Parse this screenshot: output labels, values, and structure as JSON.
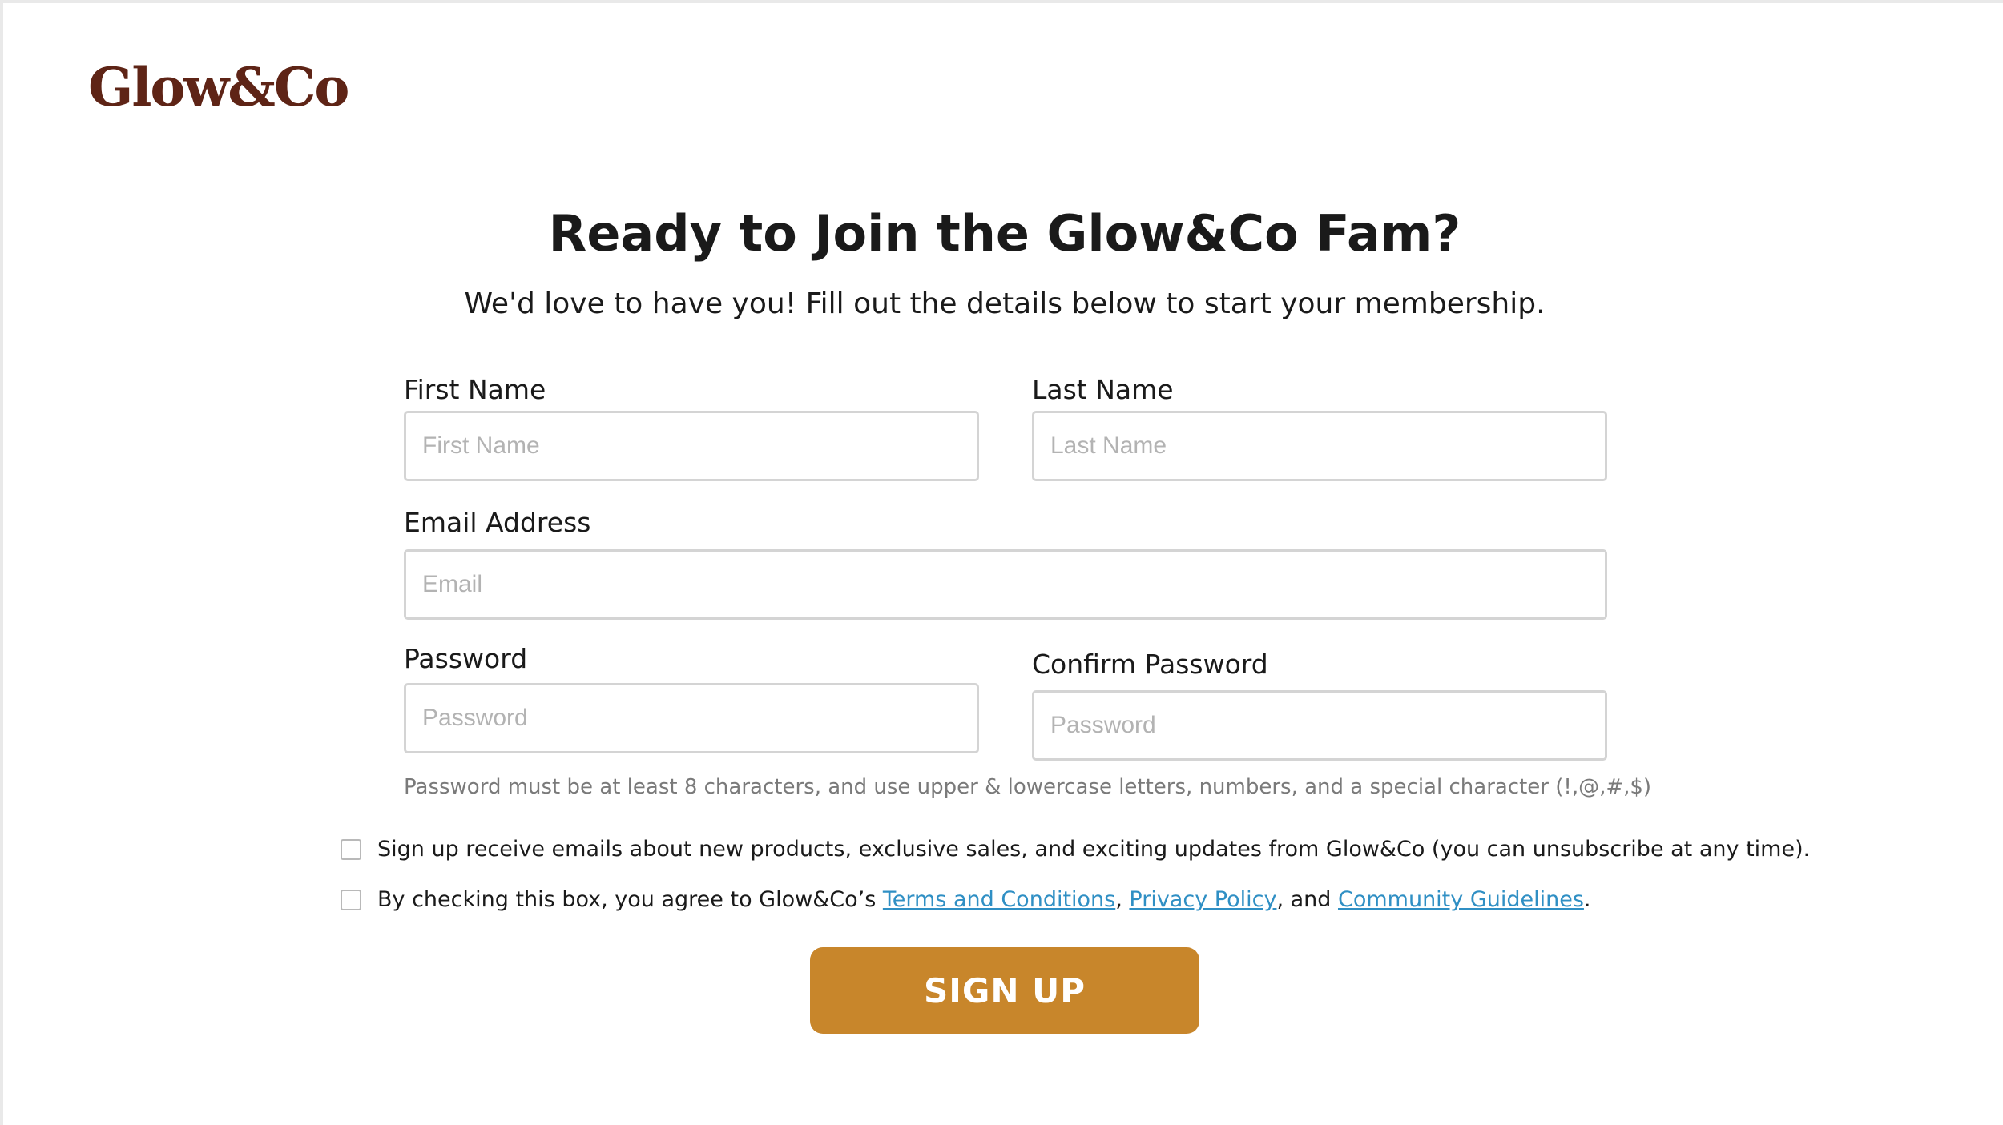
{
  "brand": {
    "logo_text": "Glow&Co",
    "logo_color": "#5e2416"
  },
  "header": {
    "title": "Ready to Join the Glow&Co Fam?",
    "subtitle": "We'd love to have you! Fill out the details below to start your membership."
  },
  "form": {
    "first_name": {
      "label": "First Name",
      "placeholder": "First Name",
      "value": ""
    },
    "last_name": {
      "label": "Last Name",
      "placeholder": "Last Name",
      "value": ""
    },
    "email": {
      "label": "Email Address",
      "placeholder": "Email",
      "value": ""
    },
    "password": {
      "label": "Password",
      "placeholder": "Password",
      "value": ""
    },
    "confirm_password": {
      "label": "Confirm Password",
      "placeholder": "Password",
      "value": ""
    },
    "password_hint": "Password must be at least 8 characters, and use upper & lowercase letters, numbers, and a special character (!,@,#,$)"
  },
  "checkboxes": {
    "newsletter": {
      "checked": false,
      "text": "Sign up receive emails about new products, exclusive sales, and exciting updates from Glow&Co (you can unsubscribe at any time)."
    },
    "terms": {
      "checked": false,
      "prefix": "By checking this box, you agree to Glow&Co’s ",
      "terms_link": "Terms and Conditions",
      "sep1": ", ",
      "privacy_link": "Privacy Policy",
      "sep2": ", and ",
      "guidelines_link": "Community Guidelines",
      "suffix": "."
    }
  },
  "submit": {
    "label": "SIGN UP",
    "color": "#c8862b"
  },
  "colors": {
    "link": "#2f8fc4",
    "input_border": "#d4d4d4",
    "text": "#1a1a1a",
    "hint": "#7a7a7a"
  }
}
